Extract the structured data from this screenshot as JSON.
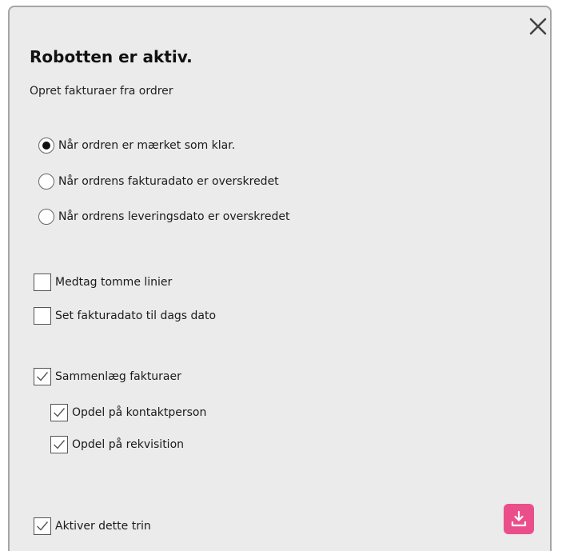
{
  "dialog": {
    "title": "Robotten er aktiv.",
    "subtitle": "Opret fakturaer fra ordrer",
    "close_icon": "close-icon"
  },
  "trigger_options": [
    {
      "label": "Når ordren er mærket som klar.",
      "checked": true
    },
    {
      "label": "Når ordrens fakturadato er overskredet",
      "checked": false
    },
    {
      "label": "Når ordrens leveringsdato er overskredet",
      "checked": false
    }
  ],
  "options": {
    "include_empty_lines": {
      "label": "Medtag tomme linier",
      "checked": false
    },
    "set_invoice_date_today": {
      "label": "Set fakturadato til dags dato",
      "checked": false
    },
    "merge_invoices": {
      "label": "Sammenlæg fakturaer",
      "checked": true
    },
    "split_by_contact": {
      "label": "Opdel på kontaktperson",
      "checked": true
    },
    "split_by_requisition": {
      "label": "Opdel på rekvisition",
      "checked": true
    },
    "activate_step": {
      "label": "Aktiver dette trin",
      "checked": true
    }
  },
  "download_button": {
    "icon": "download-icon",
    "color": "#ea4f8b"
  }
}
